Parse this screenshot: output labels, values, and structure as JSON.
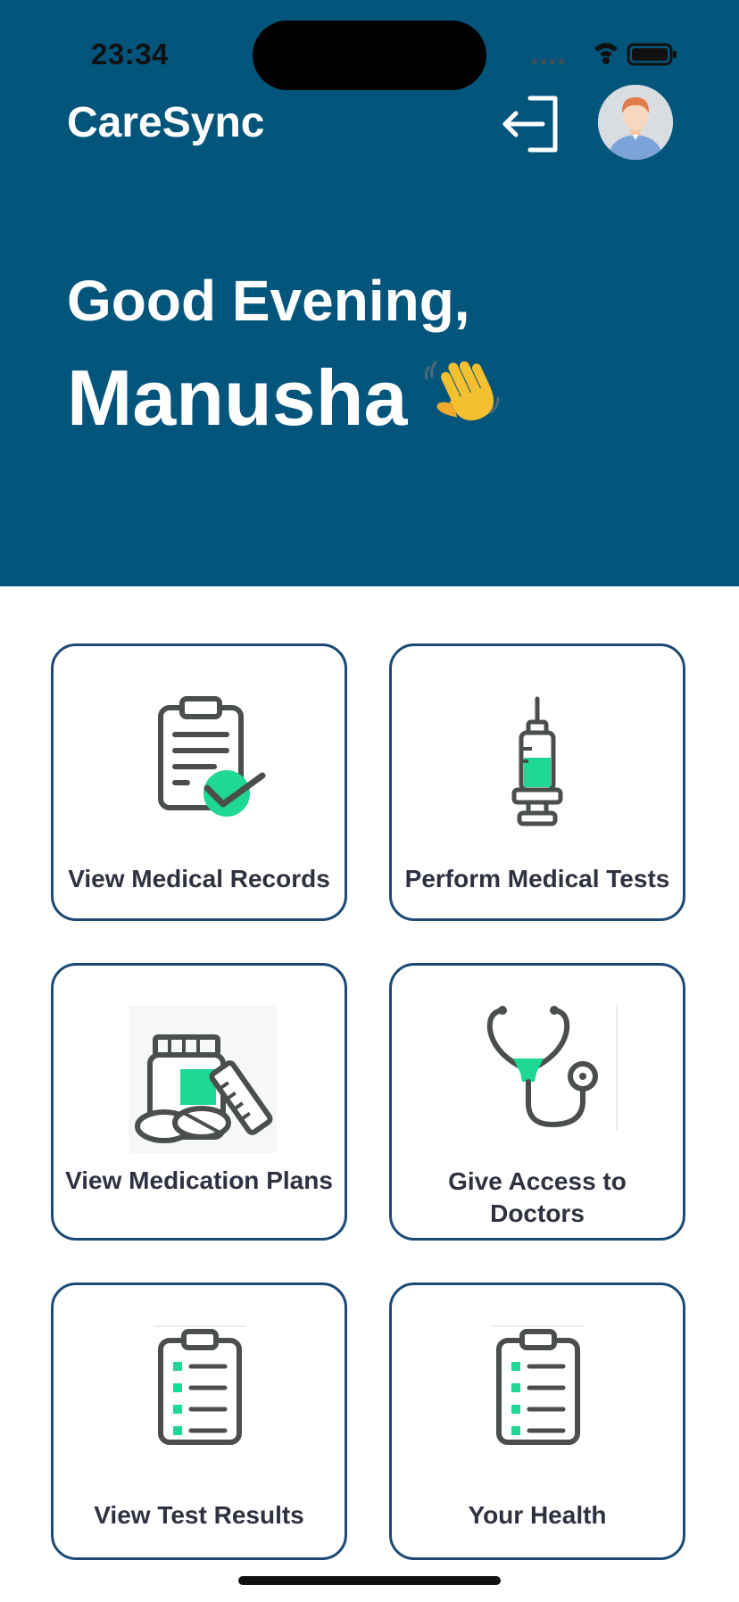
{
  "status_bar": {
    "time": "23:34"
  },
  "app": {
    "title": "CareSync"
  },
  "greeting": {
    "line1": "Good Evening,",
    "name": "Manusha"
  },
  "colors": {
    "header_bg": "#03557c",
    "accent_green": "#1ed893",
    "card_border": "#1c4a74"
  },
  "cards": [
    {
      "label": "View Medical Records",
      "icon": "clipboard-check-icon"
    },
    {
      "label": "Perform Medical Tests",
      "icon": "syringe-icon"
    },
    {
      "label": "View Medication Plans",
      "icon": "medication-icon"
    },
    {
      "label": "Give Access to Doctors",
      "icon": "stethoscope-icon"
    },
    {
      "label": "View Test Results",
      "icon": "checklist-icon"
    },
    {
      "label": "Your Health",
      "icon": "checklist-icon"
    }
  ]
}
